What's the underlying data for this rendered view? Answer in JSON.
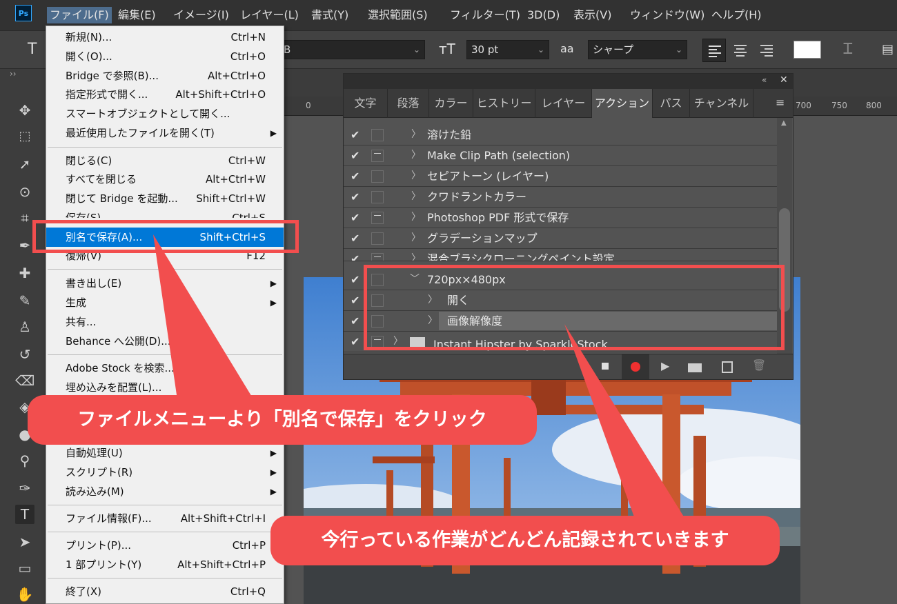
{
  "app": {
    "logo": "Ps"
  },
  "menubar": {
    "items": [
      "ファイル(F)",
      "編集(E)",
      "イメージ(I)",
      "レイヤー(L)",
      "書式(Y)",
      "選択範囲(S)",
      "フィルター(T)",
      "3D(D)",
      "表示(V)",
      "ウィンドウ(W)",
      "ヘルプ(H)"
    ]
  },
  "options": {
    "tool_letter": "T",
    "font_style_partial": "B",
    "size_value": "30 pt",
    "aa_symbol": "aa",
    "antialias": "シャープ",
    "swatch_color": "#ffffff"
  },
  "ruler": {
    "labels": [
      "0",
      "700",
      "750",
      "800"
    ]
  },
  "file_menu": {
    "items": [
      {
        "label": "新規(N)...",
        "shortcut": "Ctrl+N"
      },
      {
        "label": "開く(O)...",
        "shortcut": "Ctrl+O"
      },
      {
        "label": "Bridge で参照(B)...",
        "shortcut": "Alt+Ctrl+O"
      },
      {
        "label": "指定形式で開く...",
        "shortcut": "Alt+Shift+Ctrl+O"
      },
      {
        "label": "スマートオブジェクトとして開く...",
        "shortcut": ""
      },
      {
        "label": "最近使用したファイルを開く(T)",
        "shortcut": ""
      },
      {
        "label": "閉じる(C)",
        "shortcut": "Ctrl+W"
      },
      {
        "label": "すべてを閉じる",
        "shortcut": "Alt+Ctrl+W"
      },
      {
        "label": "閉じて Bridge を起動...",
        "shortcut": "Shift+Ctrl+W"
      },
      {
        "label": "保存(S)",
        "shortcut": "Ctrl+S"
      },
      {
        "label": "別名で保存(A)...",
        "shortcut": "Shift+Ctrl+S"
      },
      {
        "label": "復帰(V)",
        "shortcut": "F12"
      },
      {
        "label": "書き出し(E)",
        "shortcut": ""
      },
      {
        "label": "生成",
        "shortcut": ""
      },
      {
        "label": "共有...",
        "shortcut": ""
      },
      {
        "label": "Behance へ公開(D)...",
        "shortcut": ""
      },
      {
        "label": "Adobe Stock を検索...",
        "shortcut": ""
      },
      {
        "label": "埋め込みを配置(L)...",
        "shortcut": ""
      },
      {
        "label": "自動処理(U)",
        "shortcut": ""
      },
      {
        "label": "スクリプト(R)",
        "shortcut": ""
      },
      {
        "label": "読み込み(M)",
        "shortcut": ""
      },
      {
        "label": "ファイル情報(F)...",
        "shortcut": "Alt+Shift+Ctrl+I"
      },
      {
        "label": "プリント(P)...",
        "shortcut": "Ctrl+P"
      },
      {
        "label": "1 部プリント(Y)",
        "shortcut": "Alt+Shift+Ctrl+P"
      },
      {
        "label": "終了(X)",
        "shortcut": "Ctrl+Q"
      }
    ]
  },
  "panel": {
    "tabs": [
      "文字",
      "段落",
      "カラー",
      "ヒストリー",
      "レイヤー",
      "アクション",
      "パス",
      "チャンネル"
    ],
    "actions": [
      {
        "name": "溶けた鉛"
      },
      {
        "name": "Make Clip Path (selection)"
      },
      {
        "name": "セピアトーン (レイヤー)"
      },
      {
        "name": "クワドラントカラー"
      },
      {
        "name": "Photoshop PDF 形式で保存"
      },
      {
        "name": "グラデーションマップ"
      },
      {
        "name": "混合ブラシクローニングペイント設定"
      },
      {
        "name": "720px×480px"
      },
      {
        "name": "開く"
      },
      {
        "name": "画像解像度"
      },
      {
        "name": "Instant Hipster by SparkleStock"
      }
    ]
  },
  "callouts": {
    "menu_note": "ファイルメニューより「別名で保存」をクリック",
    "panel_note": "今行っている作業がどんどん記録されていきます"
  }
}
